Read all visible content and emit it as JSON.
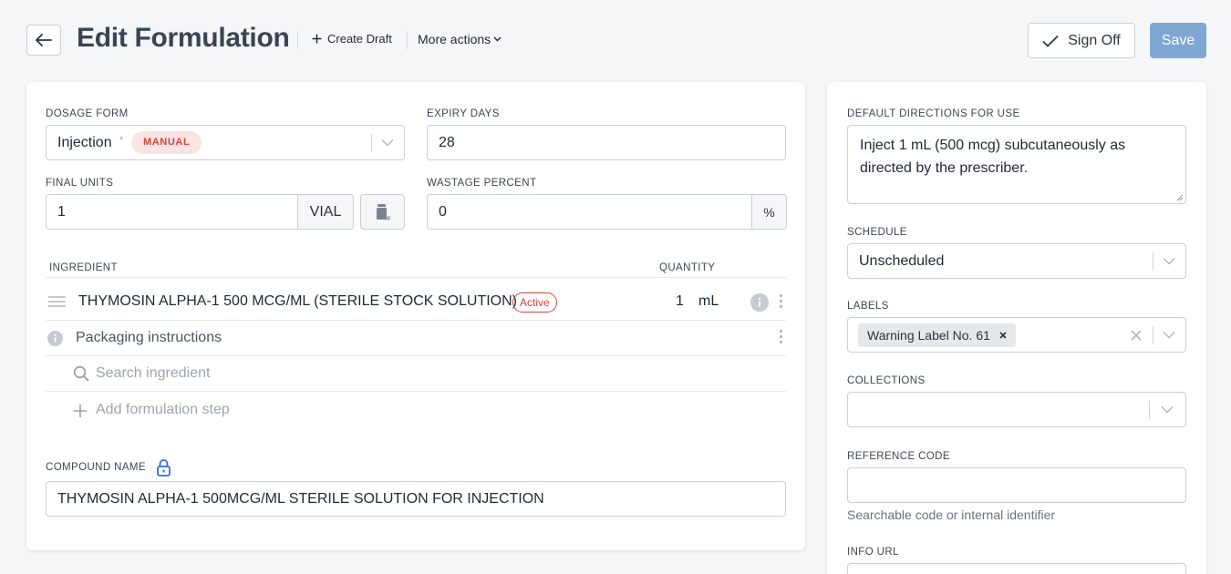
{
  "header": {
    "title": "Edit Formulation",
    "create_draft": "Create Draft",
    "more_actions": "More actions",
    "sign_off": "Sign Off",
    "save": "Save"
  },
  "left": {
    "dosage_form": {
      "label": "DOSAGE FORM",
      "value": "Injection",
      "required_mark": "*",
      "badge": "MANUAL"
    },
    "expiry_days": {
      "label": "EXPIRY DAYS",
      "value": "28"
    },
    "final_units": {
      "label": "FINAL UNITS",
      "value": "1",
      "unit": "VIAL"
    },
    "wastage": {
      "label": "WASTAGE PERCENT",
      "value": "0",
      "unit": "%"
    },
    "table": {
      "col_ingredient": "INGREDIENT",
      "col_quantity": "QUANTITY",
      "rows": [
        {
          "name": "THYMOSIN ALPHA-1 500 MCG/ML (STERILE STOCK SOLUTION)",
          "status": "Active",
          "qty": "1",
          "unit": "mL"
        }
      ],
      "packaging": "Packaging instructions",
      "search_placeholder": "Search ingredient",
      "add_step": "Add formulation step"
    },
    "compound_name": {
      "label": "COMPOUND NAME",
      "value": "THYMOSIN ALPHA-1 500MCG/ML STERILE SOLUTION FOR INJECTION"
    }
  },
  "right": {
    "directions": {
      "label": "DEFAULT DIRECTIONS FOR USE",
      "value": "Inject 1 mL (500 mcg) subcutaneously as directed by the prescriber."
    },
    "schedule": {
      "label": "SCHEDULE",
      "value": "Unscheduled"
    },
    "labels": {
      "label": "LABELS",
      "tag": "Warning Label No. 61"
    },
    "collections": {
      "label": "COLLECTIONS"
    },
    "reference_code": {
      "label": "REFERENCE CODE",
      "help": "Searchable code or internal identifier"
    },
    "info_url": {
      "label": "INFO URL"
    }
  },
  "colors": {
    "accent": "#7ea7d3",
    "danger": "#d0453a",
    "icon_blue": "#2f6fdb"
  },
  "icons": [
    "arrow-left-icon",
    "plus-icon",
    "chevron-down-icon",
    "check-icon",
    "drag-handle-icon",
    "info-icon",
    "kebab-icon",
    "search-icon",
    "lock-icon",
    "vial-calc-icon",
    "clear-icon"
  ]
}
